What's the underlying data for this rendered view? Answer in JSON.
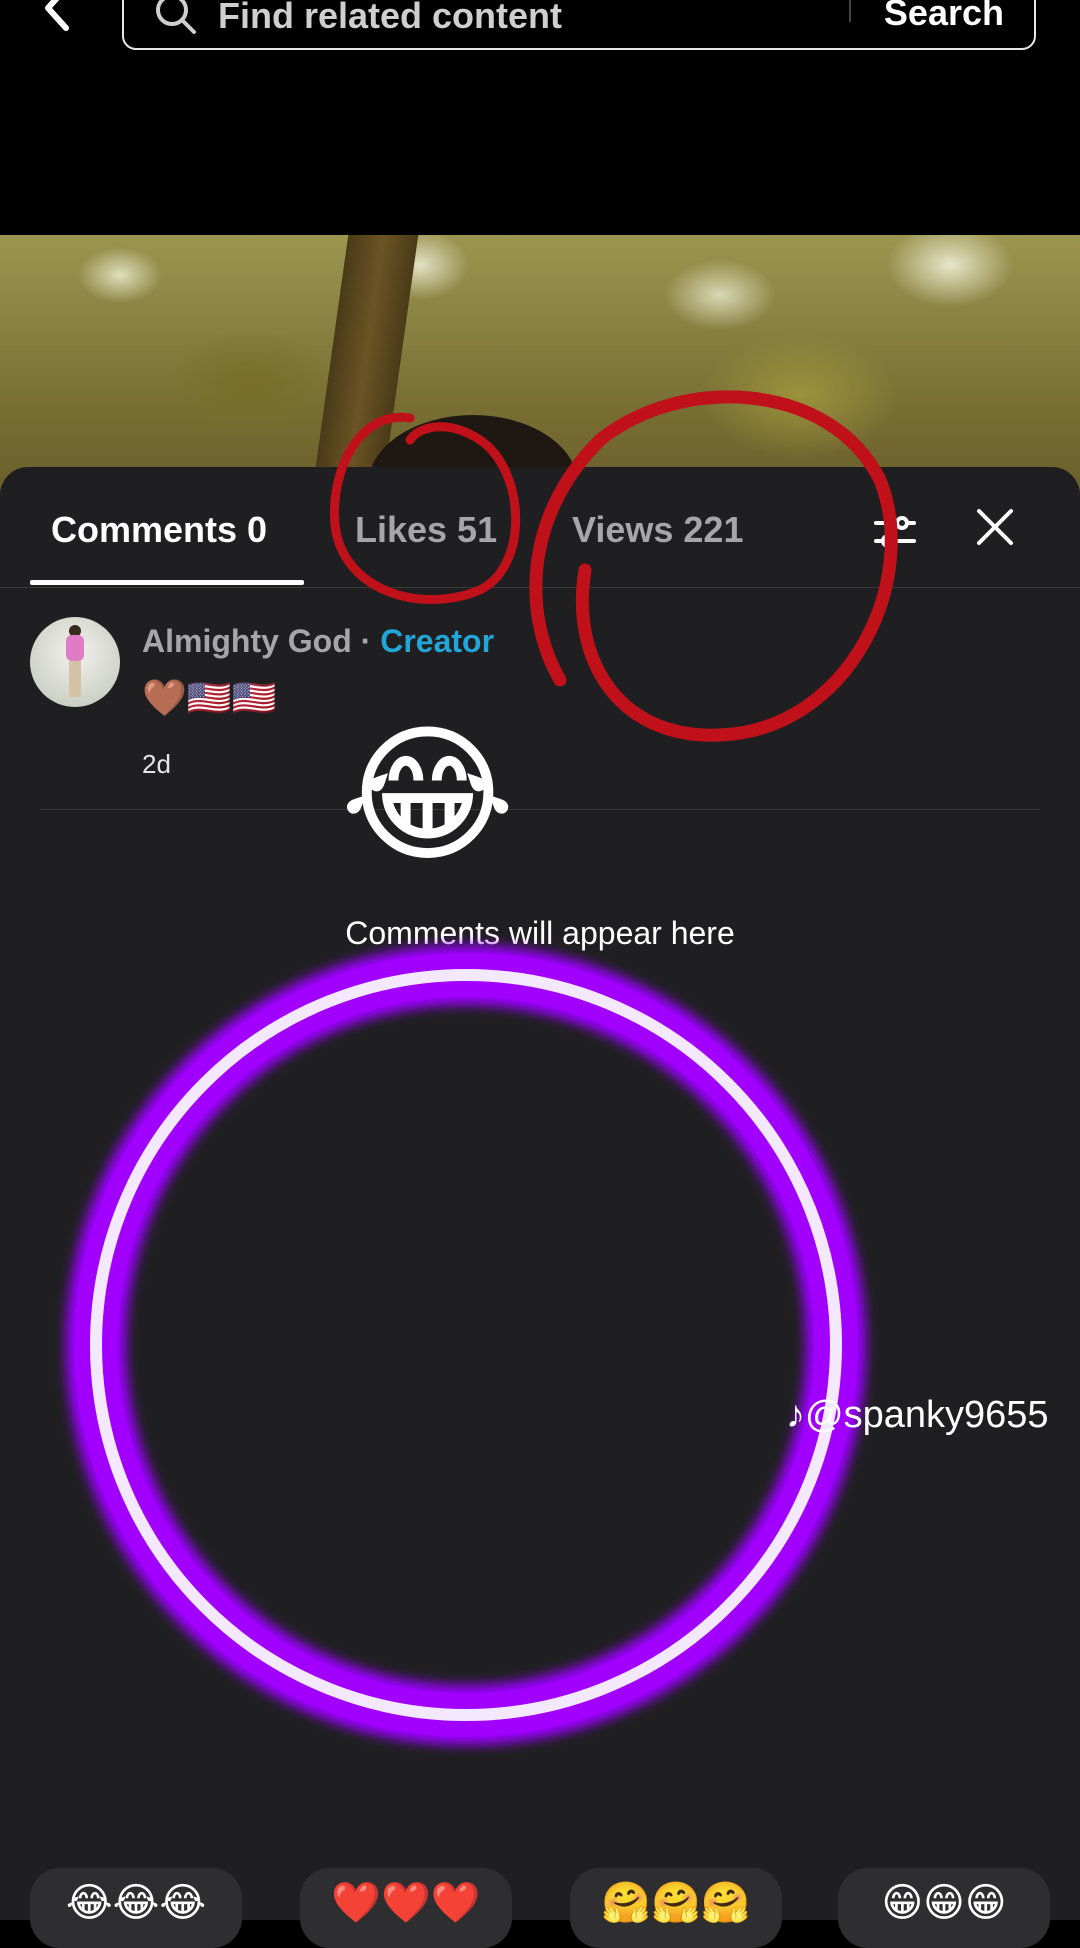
{
  "search": {
    "placeholder": "Find related content",
    "button_label": "Search"
  },
  "tabs": [
    {
      "label": "Comments 0"
    },
    {
      "label": "Likes 51"
    },
    {
      "label": "Views 221"
    }
  ],
  "comment": {
    "author": "Almighty God",
    "separator": "·",
    "badge": "Creator",
    "text": "🤎🇺🇸🇺🇸",
    "time": "2d"
  },
  "empty_state": {
    "emoji": "😂",
    "message": "Comments will appear here"
  },
  "watermark": "♪@spanky9655",
  "reactions": [
    "😂😂😂",
    "❤️❤️❤️",
    "🤗🤗🤗",
    "😁😁😁"
  ],
  "colors": {
    "sheet_bg": "#1f1f21",
    "creator_accent": "#22a6d8",
    "annotation_red": "#c0101a",
    "ring_purple": "#9b00ff"
  },
  "icons": [
    "back-arrow-icon",
    "search-icon",
    "filter-icon",
    "close-icon",
    "tiktok-logo-icon"
  ]
}
